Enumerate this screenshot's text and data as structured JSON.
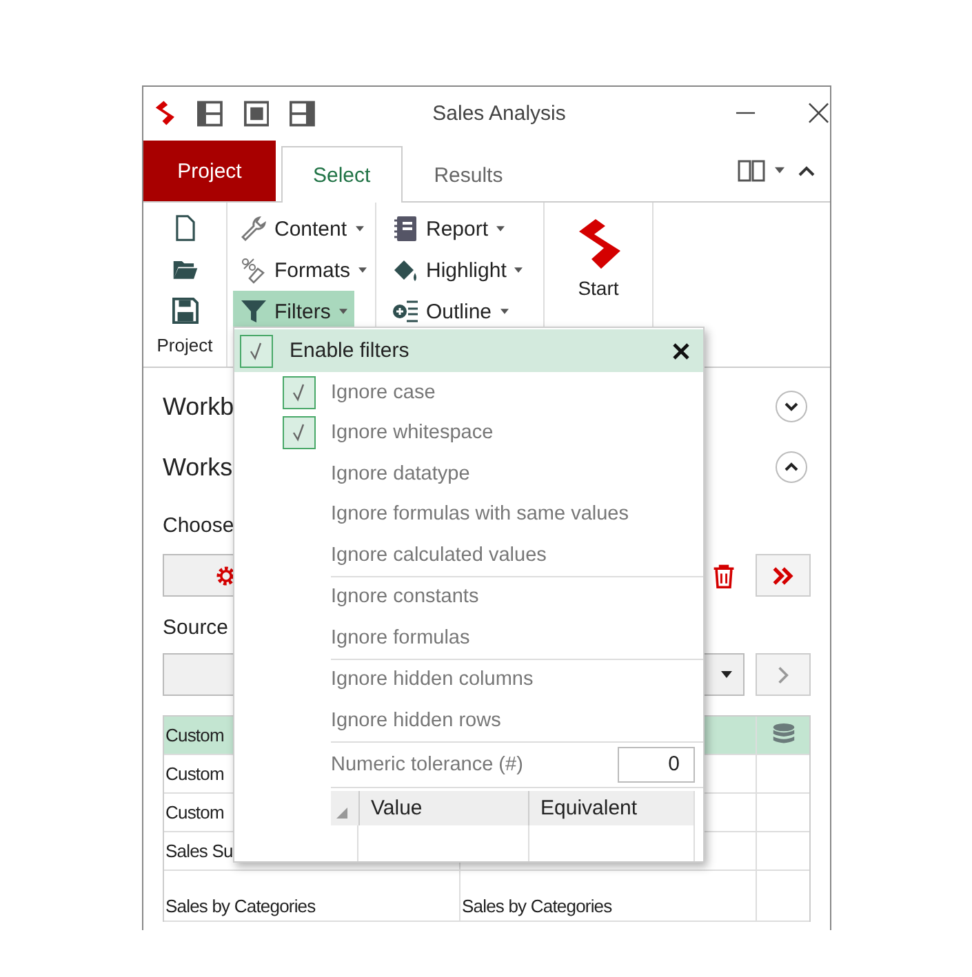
{
  "window": {
    "title": "Sales Analysis"
  },
  "tabs": [
    {
      "label": "Project",
      "kind": "app",
      "selected": false
    },
    {
      "label": "Select",
      "kind": "tab",
      "selected": true
    },
    {
      "label": "Results",
      "kind": "tab",
      "selected": false
    }
  ],
  "ribbon": {
    "project_group": {
      "label": "Project"
    },
    "group_2": [
      {
        "label": "Content",
        "selected": false
      },
      {
        "label": "Formats",
        "selected": false
      },
      {
        "label": "Filters",
        "selected": true
      }
    ],
    "group_3": [
      {
        "label": "Report"
      },
      {
        "label": "Highlight"
      },
      {
        "label": "Outline"
      }
    ],
    "start": {
      "label": "Start"
    }
  },
  "panel": {
    "sections": [
      {
        "title": "Workb",
        "expanded": false
      },
      {
        "title": "Works",
        "expanded": true
      }
    ],
    "choose_label": "Choose",
    "source_label": "Source",
    "table": {
      "rows": [
        {
          "cells": [
            "Custom",
            ""
          ],
          "selected": true
        },
        {
          "cells": [
            "Custom",
            ""
          ],
          "selected": false
        },
        {
          "cells": [
            "Custom",
            ""
          ],
          "selected": false
        },
        {
          "cells": [
            "Sales Su",
            ""
          ],
          "selected": false
        },
        {
          "cells": [
            "Sales by Categories",
            "Sales by Categories"
          ],
          "selected": false
        }
      ]
    }
  },
  "filters_menu": {
    "enable": {
      "label": "Enable filters",
      "checked": true
    },
    "groups": [
      [
        {
          "label": "Ignore case",
          "checked": true
        },
        {
          "label": "Ignore whitespace",
          "checked": true
        },
        {
          "label": "Ignore datatype",
          "checked": false
        },
        {
          "label": "Ignore formulas with same values",
          "checked": false
        },
        {
          "label": "Ignore calculated values",
          "checked": false
        }
      ],
      [
        {
          "label": "Ignore constants",
          "checked": false
        },
        {
          "label": "Ignore formulas",
          "checked": false
        }
      ],
      [
        {
          "label": "Ignore hidden columns",
          "checked": false
        },
        {
          "label": "Ignore hidden rows",
          "checked": false
        }
      ]
    ],
    "tolerance": {
      "label": "Numeric tolerance (#)",
      "value": "0"
    },
    "grid": {
      "columns": [
        "Value",
        "Equivalent"
      ]
    }
  }
}
